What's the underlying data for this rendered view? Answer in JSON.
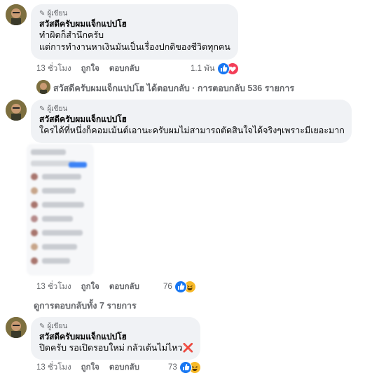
{
  "comments": [
    {
      "author_badge": "ผู้เขียน",
      "author_name": "สวัสดีครับผมแจ็กแปปโฮ",
      "lines": [
        "ทำผิดก็สำนึกครับ",
        "แต่การทำงานหาเงินมันเป็นเรื่องปกติของชีวิตทุกคน"
      ],
      "time": "13 ชั่วโมง",
      "like_label": "ถูกใจ",
      "reply_label": "ตอบกลับ",
      "reaction_count": "1.1 พัน",
      "reactions": [
        "like-icon",
        "love-icon"
      ]
    },
    {
      "author_badge": "ผู้เขียน",
      "author_name": "สวัสดีครับผมแจ็กแปปโฮ",
      "lines": [
        "ใครได้ที่หนึ่งก็คอมเม้นต์เอานะครับผมไม่สามารถตัดสินใจได้จริงๆเพราะมีเยอะมาก"
      ],
      "time": "13 ชั่วโมง",
      "like_label": "ถูกใจ",
      "reply_label": "ตอบกลับ",
      "reaction_count": "76",
      "reactions": [
        "like-icon",
        "haha-icon"
      ]
    },
    {
      "author_badge": "ผู้เขียน",
      "author_name": "สวัสดีครับผมแจ็กแปปโฮ",
      "lines": [
        "ปิดครับ รอเปิดรอบใหม่ กลัวเต้นไม่ไหว❌"
      ],
      "time": "13 ชั่วโมง",
      "like_label": "ถูกใจ",
      "reply_label": "ตอบกลับ",
      "reaction_count": "73",
      "reactions": [
        "like-icon",
        "haha-icon"
      ]
    }
  ],
  "reply_summary_1": "สวัสดีครับผมแจ็กแปปโฮ ได้ตอบกลับ · การตอบกลับ 536 รายการ",
  "reply_summary_2": "ดูการตอบกลับทั้ง 7 รายการ"
}
